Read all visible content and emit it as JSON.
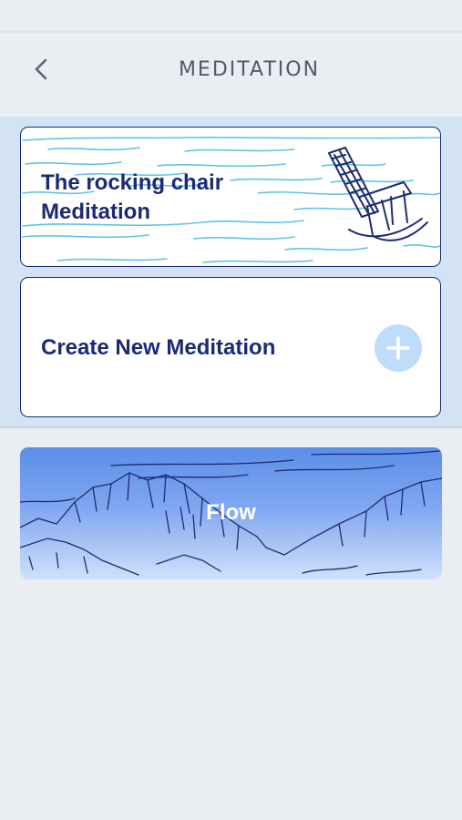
{
  "header": {
    "title": "MEDITATION",
    "back_icon": "chevron-left-icon"
  },
  "meditations": [
    {
      "title": "The rocking chair\nMeditation",
      "illustration": "rocking-chair-icon"
    }
  ],
  "create_card": {
    "label": "Create New Meditation",
    "icon": "plus-icon"
  },
  "programs": [
    {
      "title": "Flow",
      "illustration": "mountains-illustration"
    }
  ],
  "colors": {
    "accent": "#1a2a78",
    "panel": "#d4e3f3",
    "background": "#eaedf1",
    "add_button": "#bfdcfb",
    "flow_gradient_top": "#5b8ee8"
  }
}
